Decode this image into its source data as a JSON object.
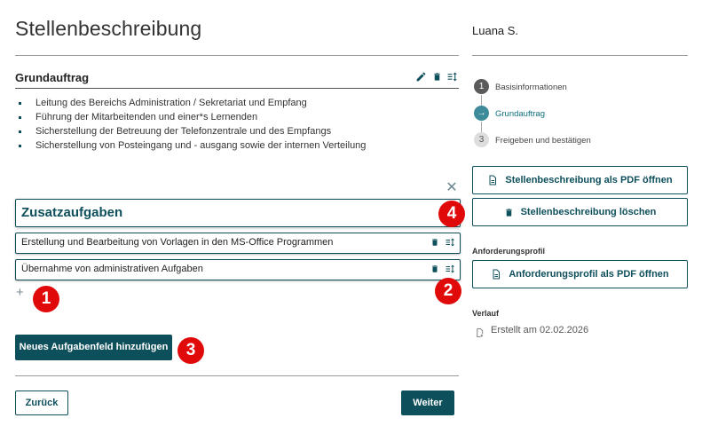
{
  "page_title": "Stellenbeschreibung",
  "grundauftrag": {
    "title": "Grundauftrag",
    "items": [
      "Leitung des Bereichs Administration / Sekretariat und Empfang",
      "Führung der Mitarbeitenden und einer*s Lernenden",
      "Sicherstellung der Betreuung der Telefonzentrale und des Empfangs",
      "Sicherstellung von Posteingang und - ausgang sowie der internen Verteilung"
    ]
  },
  "zusatzaufgaben": {
    "title": "Zusatzaufgaben",
    "tasks": [
      "Erstellung und Bearbeitung von Vorlagen in den MS-Office Programmen",
      "Übernahme von administrativen Aufgaben"
    ]
  },
  "badges": [
    "1",
    "2",
    "3",
    "4"
  ],
  "buttons": {
    "add_field": "Neues Aufgabenfeld hinzufügen",
    "back": "Zurück",
    "next": "Weiter"
  },
  "sidebar": {
    "user": "Luana S.",
    "steps": [
      {
        "number": "1",
        "label": "Basisinformationen",
        "state": "done"
      },
      {
        "number": "→",
        "label": "Grundauftrag",
        "state": "current"
      },
      {
        "number": "3",
        "label": "Freigeben und bestätigen",
        "state": "pending"
      }
    ],
    "open_pdf": "Stellenbeschreibung als PDF öffnen",
    "delete": "Stellenbeschreibung löschen",
    "anforderungsprofil_label": "Anforderungsprofil",
    "anforderungsprofil_pdf": "Anforderungsprofil als PDF öffnen",
    "verlauf_label": "Verlauf",
    "verlauf_entry": "Erstellt am 02.02.2026"
  },
  "colors": {
    "accent": "#0e4f5c",
    "badge": "#e10a0a"
  }
}
